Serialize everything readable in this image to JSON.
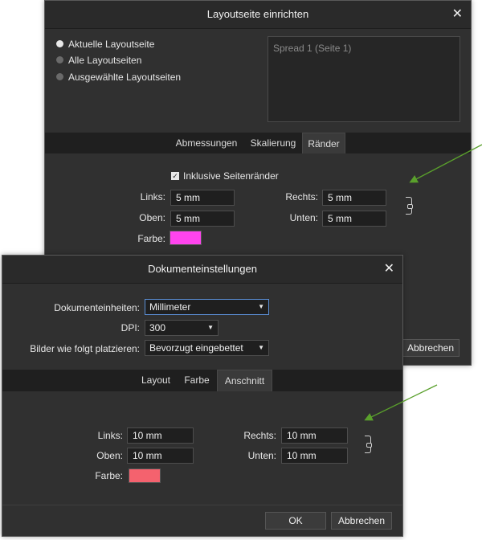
{
  "back_dialog": {
    "title": "Layoutseite einrichten",
    "scope_options": [
      {
        "label": "Aktuelle Layoutseite",
        "selected": true
      },
      {
        "label": "Alle Layoutseiten",
        "selected": false
      },
      {
        "label": "Ausgewählte Layoutseiten",
        "selected": false
      }
    ],
    "preview_item": "Spread 1 (Seite 1)",
    "tabs": [
      "Abmessungen",
      "Skalierung",
      "Ränder"
    ],
    "active_tab": "Ränder",
    "include_margins_label": "Inklusive Seitenränder",
    "links_label": "Links:",
    "links_value": "5 mm",
    "rechts_label": "Rechts:",
    "rechts_value": "5 mm",
    "oben_label": "Oben:",
    "oben_value": "5 mm",
    "unten_label": "Unten:",
    "unten_value": "5 mm",
    "farbe_label": "Farbe:",
    "farbe_color": "#ff44ee",
    "cancel_label": "Abbrechen"
  },
  "front_dialog": {
    "title": "Dokumenteinstellungen",
    "units_label": "Dokumenteinheiten:",
    "units_value": "Millimeter",
    "dpi_label": "DPI:",
    "dpi_value": "300",
    "place_label": "Bilder wie folgt platzieren:",
    "place_value": "Bevorzugt eingebettet",
    "tabs": [
      "Layout",
      "Farbe",
      "Anschnitt"
    ],
    "active_tab": "Anschnitt",
    "links_label": "Links:",
    "links_value": "10 mm",
    "rechts_label": "Rechts:",
    "rechts_value": "10 mm",
    "oben_label": "Oben:",
    "oben_value": "10 mm",
    "unten_label": "Unten:",
    "unten_value": "10 mm",
    "farbe_label": "Farbe:",
    "farbe_color": "#f4626e",
    "ok_label": "OK",
    "cancel_label": "Abbrechen"
  },
  "colors": {
    "annotation_arrow": "#5aa02c",
    "dialog_bg": "#303030",
    "tabbar_bg": "#1f1f1f"
  },
  "icons": {
    "close": "close-icon",
    "lock": "chain-link-icon",
    "dropdown": "chevron-down-icon"
  }
}
